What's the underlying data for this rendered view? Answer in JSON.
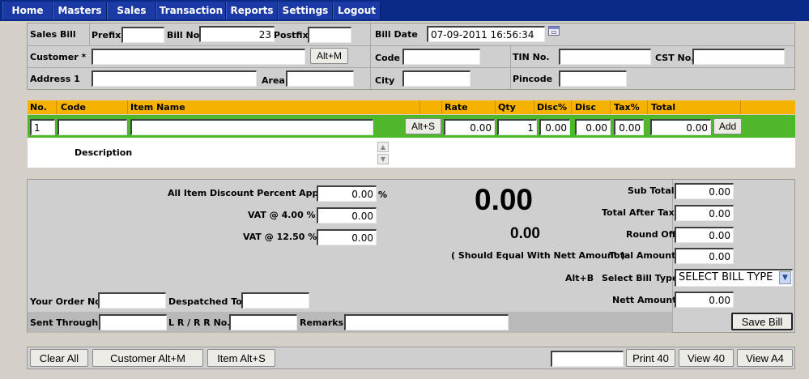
{
  "menu": [
    "Home",
    "Masters",
    "Sales",
    "Transaction",
    "Reports",
    "Settings",
    "Logout"
  ],
  "header": {
    "sales_bill_label": "Sales Bill",
    "prefix_label": "Prefix",
    "prefix_value": "",
    "bill_no_label": "Bill No.",
    "bill_no_value": "23",
    "postfix_label": "Postfix",
    "postfix_value": "",
    "bill_date_label": "Bill Date",
    "bill_date_value": "07-09-2011 16:56:34",
    "customer_label": "Customer *",
    "customer_value": "",
    "customer_shortcut_button": "Alt+M",
    "code_label": "Code",
    "code_value": "",
    "tin_label": "TIN No.",
    "tin_value": "",
    "cst_label": "CST No.",
    "cst_value": "",
    "address1_label": "Address 1",
    "address1_value": "",
    "area_label": "Area",
    "area_value": "",
    "city_label": "City",
    "city_value": "",
    "pincode_label": "Pincode",
    "pincode_value": ""
  },
  "items": {
    "columns": [
      "No.",
      "Code",
      "Item Name",
      "Rate",
      "Qty",
      "Disc%",
      "Disc",
      "Tax%",
      "Total"
    ],
    "row": {
      "no": "1",
      "code": "",
      "item_name": "",
      "item_shortcut": "Alt+S",
      "rate": "0.00",
      "qty": "1",
      "disc_pct": "0.00",
      "disc": "0.00",
      "tax_pct": "0.00",
      "total": "0.00",
      "add_button": "Add"
    },
    "description_label": "Description"
  },
  "summary": {
    "all_item_discount_label": "All Item Discount Percent Apply",
    "all_item_discount_value": "0.00",
    "percent_sign": "%",
    "vat4_label": "VAT @ 4.00 %",
    "vat4_value": "0.00",
    "vat12_label": "VAT @ 12.50 %",
    "vat12_value": "0.00",
    "big_amount": "0.00",
    "small_amount": "0.00",
    "equal_note": "( Should Equal With Nett Amount )",
    "sub_total_label": "Sub Total",
    "sub_total_value": "0.00",
    "after_tax_label": "Total After Tax",
    "after_tax_value": "0.00",
    "round_off_label": "Round Off",
    "round_off_value": "0.00",
    "total_amount_label": "Total Amount",
    "total_amount_value": "0.00",
    "bill_type_shortcut": "Alt+B",
    "bill_type_label": "Select Bill Type",
    "bill_type_value": "SELECT BILL TYPE",
    "nett_amount_label": "Nett Amount",
    "nett_amount_value": "0.00",
    "your_order_label": "Your Order No:",
    "your_order_value": "",
    "despatched_label": "Despatched To:",
    "despatched_value": "",
    "sent_through_label": "Sent Through :",
    "sent_through_value": "",
    "lr_label": "L R / R R No.:",
    "lr_value": "",
    "remarks_label": "Remarks",
    "remarks_value": "",
    "save_button": "Save Bill"
  },
  "footer": {
    "clear_all": "Clear All",
    "customer_btn": "Customer Alt+M",
    "item_btn": "Item Alt+S",
    "print_input": "",
    "print40": "Print 40",
    "view40": "View 40",
    "viewa4": "View A4"
  }
}
